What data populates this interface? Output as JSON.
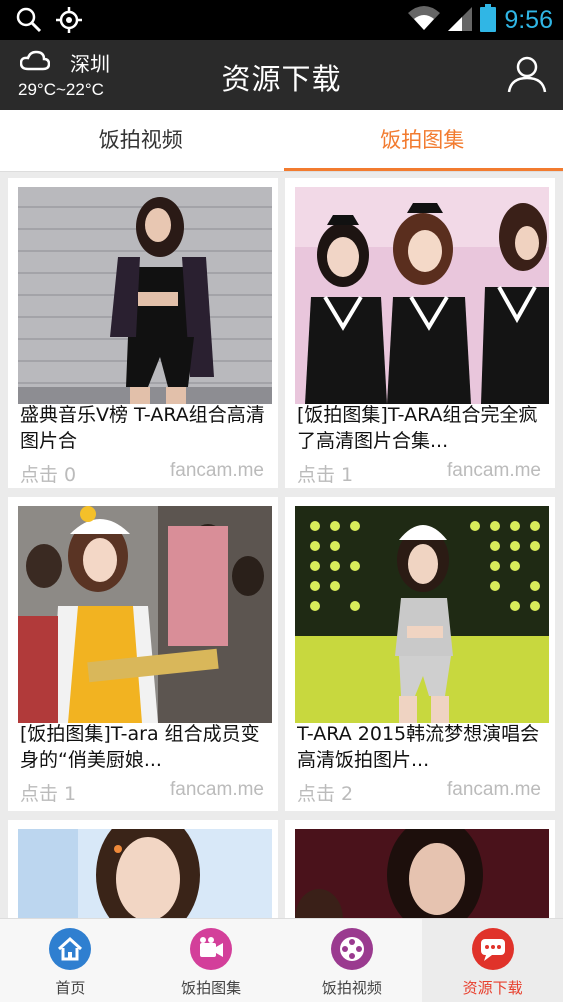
{
  "status_bar": {
    "time": "9:56",
    "icons": [
      "search-icon",
      "gps-icon",
      "wifi-icon",
      "signal-icon",
      "battery-icon"
    ],
    "time_color": "#30b6e5"
  },
  "header": {
    "title": "资源下载",
    "weather_city": "深圳",
    "weather_temp": "29°C~22°C",
    "weather_icon": "cloud-icon",
    "user_icon": "user-icon"
  },
  "tabs": [
    {
      "label": "饭拍视频",
      "active": false
    },
    {
      "label": "饭拍图集",
      "active": true
    }
  ],
  "accent_color": "#f27b2f",
  "cards": [
    {
      "title": "盛典音乐V榜 T-ARA组合高清图片合",
      "clicks": "点击 0",
      "source": "fancam.me"
    },
    {
      "title": "[饭拍图集]T-ARA组合完全疯了高清图片合集...",
      "clicks": "点击 1",
      "source": "fancam.me"
    },
    {
      "title": "[饭拍图集]T-ara 组合成员变身的“俏美厨娘...",
      "clicks": "点击 1",
      "source": "fancam.me"
    },
    {
      "title": "T-ARA 2015韩流梦想演唱会 高清饭拍图片...",
      "clicks": "点击 2",
      "source": "fancam.me"
    },
    {
      "title": "",
      "clicks": "",
      "source": ""
    },
    {
      "title": "",
      "clicks": "",
      "source": ""
    }
  ],
  "bottom_nav": [
    {
      "label": "首页",
      "icon": "home-icon",
      "color": "#2f7fd0"
    },
    {
      "label": "饭拍图集",
      "icon": "camera-icon",
      "color": "#d33f9a"
    },
    {
      "label": "饭拍视频",
      "icon": "film-reel-icon",
      "color": "#9a3a8f"
    },
    {
      "label": "资源下载",
      "icon": "chat-icon",
      "color": "#e0322a",
      "active": true
    }
  ]
}
